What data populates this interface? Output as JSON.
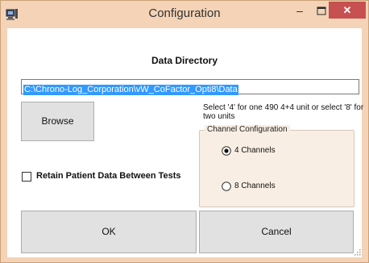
{
  "window": {
    "title": "Configuration",
    "controls": {
      "minimize": "–",
      "maximize": "maximize-icon",
      "close": "✕"
    },
    "app_icon": "monitor-app-icon"
  },
  "form": {
    "heading": "Data Directory",
    "path_value": "C:\\Chrono-Log_Corporation\\vW_CoFactor_Opti8\\Data",
    "browse_label": "Browse",
    "hint": "Select '4' for one 490 4+4 unit or select '8' for two units",
    "group_title": "Channel Configuration",
    "channel_options": [
      {
        "label": "4 Channels",
        "checked": true
      },
      {
        "label": "8 Channels",
        "checked": false
      }
    ],
    "retain_label": "Retain Patient Data Between Tests",
    "retain_checked": false,
    "ok_label": "OK",
    "cancel_label": "Cancel"
  },
  "colors": {
    "frame": "#f4d3b6",
    "close_button": "#c75050",
    "selection": "#3399ff",
    "group_background": "#f9eee3",
    "button_face": "#e1e1e1"
  }
}
